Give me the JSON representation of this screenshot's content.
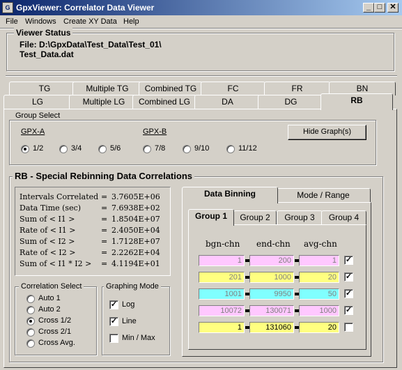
{
  "window": {
    "title": "GpxViewer: Correlator Data Viewer",
    "app_icon": "gpx-app-icon"
  },
  "menu": [
    "File",
    "Windows",
    "Create XY Data",
    "Help"
  ],
  "viewer_status": {
    "label": "Viewer  Status",
    "file_line1": "File: D:\\GpxData\\Test_Data\\Test_01\\",
    "file_line2": "Test_Data.dat"
  },
  "tabs_row1": [
    "TG",
    "Multiple TG",
    "Combined TG",
    "FC",
    "FR",
    "BN"
  ],
  "tabs_row2": [
    "LG",
    "Multiple LG",
    "Combined LG",
    "DA",
    "DG",
    "RB"
  ],
  "active_tab": "RB",
  "group_select": {
    "label": "Group Select",
    "gpxa_label": "GPX-A",
    "gpxb_label": "GPX-B",
    "hide_button": "Hide Graph(s)",
    "options": [
      "1/2",
      "3/4",
      "5/6",
      "7/8",
      "9/10",
      "11/12"
    ],
    "selected": "1/2"
  },
  "rb_section": {
    "title": "RB - Special Rebinning Data Correlations",
    "stats": [
      {
        "label": "Intervals Correlated",
        "value": "3.7605E+06"
      },
      {
        "label": "Data Time (sec)",
        "value": "7.6938E+02"
      },
      {
        "label": "Sum of < I1 >",
        "value": "1.8504E+07"
      },
      {
        "label": "Rate of < I1 >",
        "value": "2.4050E+04"
      },
      {
        "label": "Sum of < I2 >",
        "value": "1.7128E+07"
      },
      {
        "label": "Rate of < I2 >",
        "value": "2.2262E+04"
      },
      {
        "label": "Sum of < I1 * I2 >",
        "value": "4.1194E+01"
      }
    ]
  },
  "correlation_select": {
    "label": "Correlation Select",
    "options": [
      "Auto 1",
      "Auto 2",
      "Cross 1/2",
      "Cross 2/1",
      "Cross Avg."
    ],
    "selected": "Cross 1/2"
  },
  "graphing_mode": {
    "label": "Graphing  Mode",
    "options": [
      {
        "label": "Log",
        "checked": true
      },
      {
        "label": "Line",
        "checked": true
      },
      {
        "label": "Min / Max",
        "checked": false
      }
    ]
  },
  "binning": {
    "tabs": [
      "Data Binning",
      "Mode / Range"
    ],
    "active_tab": "Data Binning",
    "group_tabs": [
      "Group 1",
      "Group 2",
      "Group 3",
      "Group 4"
    ],
    "active_group": "Group 1",
    "headers": [
      "bgn-chn",
      "end-chn",
      "avg-chn"
    ],
    "rows": [
      {
        "bgn": "1",
        "end": "200",
        "avg": "1",
        "color": "#ffc8ff",
        "text_color": "#808080",
        "checked": true
      },
      {
        "bgn": "201",
        "end": "1000",
        "avg": "20",
        "color": "#ffff80",
        "text_color": "#808080",
        "checked": true
      },
      {
        "bgn": "1001",
        "end": "9950",
        "avg": "50",
        "color": "#80ffff",
        "text_color": "#808080",
        "checked": true
      },
      {
        "bgn": "10072",
        "end": "130071",
        "avg": "1000",
        "color": "#ffc8ff",
        "text_color": "#808080",
        "checked": true
      },
      {
        "bgn": "1",
        "end": "131060",
        "avg": "20",
        "color": "#ffff80",
        "text_color": "#000000",
        "checked": false
      }
    ]
  }
}
